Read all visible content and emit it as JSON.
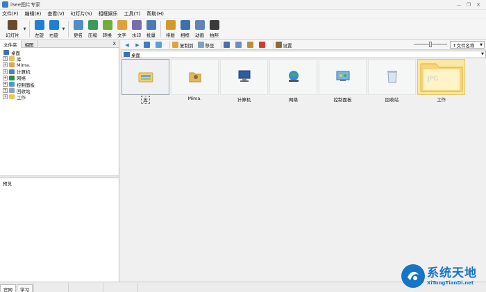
{
  "window": {
    "title": "iSee图片专家",
    "minimize": "—",
    "restore": "❐",
    "close": "✕"
  },
  "menu": [
    "文件(F)",
    "编辑(E)",
    "查看(V)",
    "幻灯片(S)",
    "相框娱乐",
    "工具(T)",
    "帮助(H)"
  ],
  "toolbar": {
    "items": [
      {
        "label": "幻灯片",
        "icon": "slideshow-icon",
        "color": "#6a4a2a",
        "wide": true,
        "drop": true
      },
      {
        "label": "左旋",
        "icon": "rotate-left-icon",
        "color": "#1f7fd1"
      },
      {
        "label": "右旋",
        "icon": "rotate-right-icon",
        "color": "#1f7fd1",
        "drop": true
      },
      {
        "label": "更名",
        "icon": "rename-icon",
        "color": "#4f8ec9"
      },
      {
        "label": "压缩",
        "icon": "compress-icon",
        "color": "#3c9a58"
      },
      {
        "label": "转换",
        "icon": "convert-icon",
        "color": "#6fae3a"
      },
      {
        "label": "文字",
        "icon": "text-icon",
        "color": "#e0a13a"
      },
      {
        "label": "水印",
        "icon": "watermark-icon",
        "color": "#7a6bb0"
      },
      {
        "label": "批量",
        "icon": "batch-icon",
        "color": "#4a7bb5"
      },
      {
        "label": "排版",
        "icon": "layout-icon",
        "color": "#d19b2a"
      },
      {
        "label": "相框",
        "icon": "frame-icon",
        "color": "#3b6fb0"
      },
      {
        "label": "动画",
        "icon": "animation-icon",
        "color": "#5e85b8"
      },
      {
        "label": "拍照",
        "icon": "camera-icon",
        "color": "#3a3a3a"
      }
    ]
  },
  "left": {
    "tabs": [
      "文件夹",
      "相图"
    ],
    "close": "X",
    "tree": [
      {
        "label": "桌面",
        "icon": "desktop-icon",
        "color": "#3b6fb8",
        "root": true
      },
      {
        "label": "库",
        "icon": "library-icon",
        "color": "#e9c35a"
      },
      {
        "label": "Mima.",
        "icon": "user-folder-icon",
        "color": "#d8a84a"
      },
      {
        "label": "计算机",
        "icon": "computer-icon",
        "color": "#4c80c0"
      },
      {
        "label": "网络",
        "icon": "network-icon",
        "color": "#2a8f4a"
      },
      {
        "label": "控制面板",
        "icon": "control-panel-icon",
        "color": "#4a9ad0"
      },
      {
        "label": "回收站",
        "icon": "recycle-bin-icon",
        "color": "#8fa3b8"
      },
      {
        "label": "工作",
        "icon": "folder-icon",
        "color": "#f0c64a"
      }
    ],
    "expander": "+",
    "preview_label": "预览"
  },
  "nav": {
    "back": "◀",
    "forward": "▶",
    "copy_to": "复制到",
    "move_to": "移至",
    "settings": "设置",
    "sort": "↑文件名称",
    "dropdown": "▼"
  },
  "address": {
    "text": "桌面"
  },
  "thumbs": [
    {
      "label": "库",
      "icon": "library-icon",
      "selected": true
    },
    {
      "label": "Mima.",
      "icon": "user-folder-icon"
    },
    {
      "label": "计算机",
      "icon": "computer-icon"
    },
    {
      "label": "网络",
      "icon": "network-icon"
    },
    {
      "label": "控制面板",
      "icon": "control-panel-icon"
    },
    {
      "label": "回收站",
      "icon": "recycle-bin-icon"
    },
    {
      "label": "工作",
      "icon": "folder-icon",
      "yellow": true
    }
  ],
  "status": {
    "tabs": [
      "官网",
      "学习"
    ]
  },
  "watermark": {
    "cn": "系统天地",
    "en": "XiTongTianDi.net"
  }
}
